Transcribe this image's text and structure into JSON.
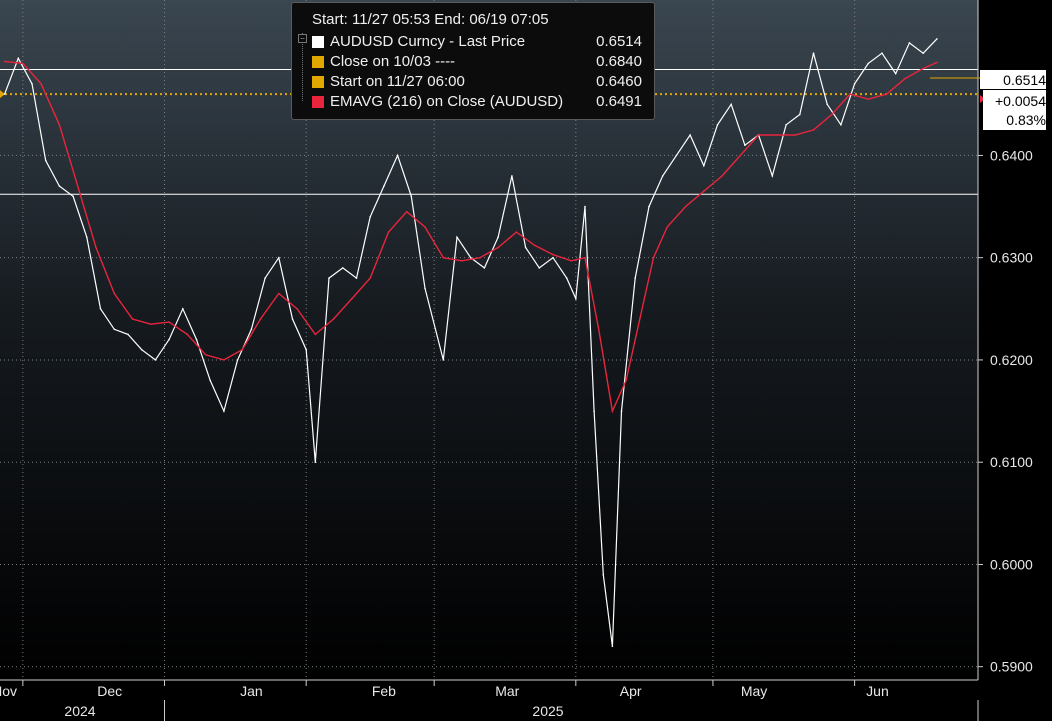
{
  "legend": {
    "header": "Start: 11/27 05:53 End: 06/19 07:05",
    "rows": [
      {
        "label": "AUDUSD Curncy - Last Price",
        "value": "0.6514",
        "color": "#ffffff"
      },
      {
        "label": "Close on 10/03 ----",
        "value": "0.6840",
        "color": "#e0a800"
      },
      {
        "label": "Start on 11/27 06:00",
        "value": "0.6460",
        "color": "#e0a800"
      },
      {
        "label": "EMAVG (216)  on Close (AUDUSD)",
        "value": "0.6491",
        "color": "#e8253c"
      }
    ]
  },
  "tags": {
    "last": "0.6514",
    "change": "+0.0054",
    "pct": "0.83%"
  },
  "chart_data": {
    "type": "line",
    "title": "",
    "xlabel": "",
    "ylabel": "",
    "ylim": [
      0.5887,
      0.6552
    ],
    "yticks": [
      0.59,
      0.6,
      0.61,
      0.62,
      0.63,
      0.64
    ],
    "ytick_labels": [
      "0.5900",
      "0.6000",
      "0.6100",
      "0.6200",
      "0.6300",
      "0.6400"
    ],
    "xticks": [
      "Nov",
      "Dec",
      "Jan",
      "Feb",
      "Mar",
      "Apr",
      "May",
      "Jun"
    ],
    "year_labels": [
      "2024",
      "2025"
    ],
    "grid": true,
    "reference_lines": [
      {
        "name": "Start on 11/27 06:00",
        "value": 0.646,
        "style": "dotted",
        "color": "#e0a800"
      },
      {
        "value": 0.6484,
        "style": "solid",
        "color": "#ffffff"
      },
      {
        "value": 0.6362,
        "style": "solid",
        "color": "#ffffff"
      }
    ],
    "series": [
      {
        "name": "AUDUSD Curncy - Last Price",
        "color": "#ffffff",
        "values": [
          [
            "2024-11-27",
            0.646
          ],
          [
            "2024-11-30",
            0.6495
          ],
          [
            "2024-12-03",
            0.647
          ],
          [
            "2024-12-06",
            0.6395
          ],
          [
            "2024-12-09",
            0.637
          ],
          [
            "2024-12-12",
            0.636
          ],
          [
            "2024-12-15",
            0.632
          ],
          [
            "2024-12-18",
            0.625
          ],
          [
            "2024-12-21",
            0.623
          ],
          [
            "2024-12-24",
            0.6225
          ],
          [
            "2024-12-27",
            0.621
          ],
          [
            "2024-12-30",
            0.62
          ],
          [
            "2025-01-02",
            0.622
          ],
          [
            "2025-01-05",
            0.625
          ],
          [
            "2025-01-08",
            0.622
          ],
          [
            "2025-01-11",
            0.618
          ],
          [
            "2025-01-14",
            0.615
          ],
          [
            "2025-01-17",
            0.62
          ],
          [
            "2025-01-20",
            0.623
          ],
          [
            "2025-01-23",
            0.628
          ],
          [
            "2025-01-26",
            0.63
          ],
          [
            "2025-01-29",
            0.624
          ],
          [
            "2025-02-01",
            0.621
          ],
          [
            "2025-02-03",
            0.61
          ],
          [
            "2025-02-06",
            0.628
          ],
          [
            "2025-02-09",
            0.629
          ],
          [
            "2025-02-12",
            0.628
          ],
          [
            "2025-02-15",
            0.634
          ],
          [
            "2025-02-18",
            0.637
          ],
          [
            "2025-02-21",
            0.64
          ],
          [
            "2025-02-24",
            0.636
          ],
          [
            "2025-02-27",
            0.627
          ],
          [
            "2025-03-03",
            0.62
          ],
          [
            "2025-03-06",
            0.632
          ],
          [
            "2025-03-09",
            0.63
          ],
          [
            "2025-03-12",
            0.629
          ],
          [
            "2025-03-15",
            0.632
          ],
          [
            "2025-03-18",
            0.638
          ],
          [
            "2025-03-21",
            0.631
          ],
          [
            "2025-03-24",
            0.629
          ],
          [
            "2025-03-27",
            0.63
          ],
          [
            "2025-03-30",
            0.628
          ],
          [
            "2025-04-01",
            0.626
          ],
          [
            "2025-04-03",
            0.635
          ],
          [
            "2025-04-05",
            0.615
          ],
          [
            "2025-04-07",
            0.599
          ],
          [
            "2025-04-09",
            0.592
          ],
          [
            "2025-04-11",
            0.615
          ],
          [
            "2025-04-14",
            0.628
          ],
          [
            "2025-04-17",
            0.635
          ],
          [
            "2025-04-20",
            0.638
          ],
          [
            "2025-04-23",
            0.64
          ],
          [
            "2025-04-26",
            0.642
          ],
          [
            "2025-04-29",
            0.639
          ],
          [
            "2025-05-02",
            0.643
          ],
          [
            "2025-05-05",
            0.645
          ],
          [
            "2025-05-08",
            0.641
          ],
          [
            "2025-05-11",
            0.642
          ],
          [
            "2025-05-14",
            0.638
          ],
          [
            "2025-05-17",
            0.643
          ],
          [
            "2025-05-20",
            0.644
          ],
          [
            "2025-05-23",
            0.65
          ],
          [
            "2025-05-26",
            0.645
          ],
          [
            "2025-05-29",
            0.643
          ],
          [
            "2025-06-01",
            0.647
          ],
          [
            "2025-06-04",
            0.649
          ],
          [
            "2025-06-07",
            0.65
          ],
          [
            "2025-06-10",
            0.648
          ],
          [
            "2025-06-13",
            0.651
          ],
          [
            "2025-06-16",
            0.65
          ],
          [
            "2025-06-19",
            0.6514
          ]
        ]
      },
      {
        "name": "EMAVG (216)  on Close (AUDUSD)",
        "color": "#e8253c",
        "values": [
          [
            "2024-11-27",
            0.6492
          ],
          [
            "2024-12-01",
            0.649
          ],
          [
            "2024-12-05",
            0.647
          ],
          [
            "2024-12-09",
            0.643
          ],
          [
            "2024-12-13",
            0.637
          ],
          [
            "2024-12-17",
            0.631
          ],
          [
            "2024-12-21",
            0.6265
          ],
          [
            "2024-12-25",
            0.624
          ],
          [
            "2024-12-29",
            0.6235
          ],
          [
            "2025-01-02",
            0.6237
          ],
          [
            "2025-01-06",
            0.6225
          ],
          [
            "2025-01-10",
            0.6205
          ],
          [
            "2025-01-14",
            0.62
          ],
          [
            "2025-01-18",
            0.621
          ],
          [
            "2025-01-22",
            0.624
          ],
          [
            "2025-01-26",
            0.6265
          ],
          [
            "2025-01-30",
            0.625
          ],
          [
            "2025-02-03",
            0.6225
          ],
          [
            "2025-02-07",
            0.624
          ],
          [
            "2025-02-11",
            0.626
          ],
          [
            "2025-02-15",
            0.628
          ],
          [
            "2025-02-19",
            0.6325
          ],
          [
            "2025-02-23",
            0.6345
          ],
          [
            "2025-02-27",
            0.633
          ],
          [
            "2025-03-03",
            0.63
          ],
          [
            "2025-03-07",
            0.6297
          ],
          [
            "2025-03-11",
            0.63
          ],
          [
            "2025-03-15",
            0.631
          ],
          [
            "2025-03-19",
            0.6325
          ],
          [
            "2025-03-23",
            0.6312
          ],
          [
            "2025-03-27",
            0.6303
          ],
          [
            "2025-03-31",
            0.6297
          ],
          [
            "2025-04-03",
            0.63
          ],
          [
            "2025-04-06",
            0.623
          ],
          [
            "2025-04-09",
            0.615
          ],
          [
            "2025-04-12",
            0.618
          ],
          [
            "2025-04-15",
            0.624
          ],
          [
            "2025-04-18",
            0.63
          ],
          [
            "2025-04-21",
            0.633
          ],
          [
            "2025-04-25",
            0.635
          ],
          [
            "2025-04-29",
            0.6365
          ],
          [
            "2025-05-03",
            0.638
          ],
          [
            "2025-05-07",
            0.64
          ],
          [
            "2025-05-11",
            0.642
          ],
          [
            "2025-05-15",
            0.642
          ],
          [
            "2025-05-19",
            0.642
          ],
          [
            "2025-05-23",
            0.6425
          ],
          [
            "2025-05-27",
            0.644
          ],
          [
            "2025-05-31",
            0.646
          ],
          [
            "2025-06-04",
            0.6455
          ],
          [
            "2025-06-08",
            0.646
          ],
          [
            "2025-06-12",
            0.6475
          ],
          [
            "2025-06-16",
            0.6485
          ],
          [
            "2025-06-19",
            0.6491
          ]
        ]
      }
    ]
  }
}
